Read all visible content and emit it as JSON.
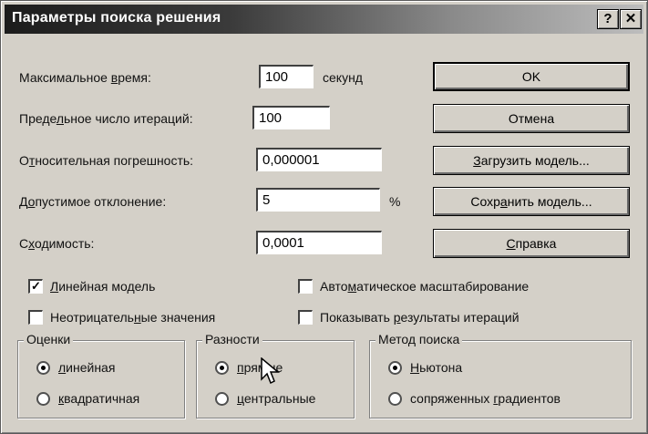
{
  "window": {
    "title": "Параметры поиска решения",
    "help_btn": "?",
    "close_btn": "✕"
  },
  "params": {
    "max_time_label_pre": "Максимальное ",
    "max_time_label_ul": "в",
    "max_time_label_post": "ремя:",
    "max_time_value": "100",
    "max_time_unit": "секунд",
    "iterations_label_pre": "Преде",
    "iterations_label_ul": "л",
    "iterations_label_post": "ьное число итераций:",
    "iterations_value": "100",
    "precision_label_pre": "О",
    "precision_label_ul": "т",
    "precision_label_post": "носительная погрешность:",
    "precision_value": "0,000001",
    "tolerance_label_pre": "Д",
    "tolerance_label_ul": "о",
    "tolerance_label_post": "пустимое отклонение:",
    "tolerance_value": "5",
    "tolerance_unit": "%",
    "convergence_label_pre": "С",
    "convergence_label_ul": "х",
    "convergence_label_post": "одимость:",
    "convergence_value": "0,0001"
  },
  "buttons": {
    "ok": "OK",
    "cancel": "Отмена",
    "load_pre": "",
    "load_ul": "З",
    "load_post": "агрузить модель...",
    "save_pre": "Сохр",
    "save_ul": "а",
    "save_post": "нить модель...",
    "help_pre": "",
    "help_ul": "С",
    "help_post": "правка"
  },
  "options": {
    "linear_model": {
      "pre": "",
      "ul": "Л",
      "post": "инейная модель",
      "checked": true
    },
    "nonnegative": {
      "pre": "Неотрицатель",
      "ul": "н",
      "post": "ые значения",
      "checked": false
    },
    "auto_scale": {
      "pre": "Авто",
      "ul": "м",
      "post": "атическое масштабирование",
      "checked": false
    },
    "show_iterations": {
      "pre": "Показывать ",
      "ul": "р",
      "post": "езультаты итераций",
      "checked": false
    },
    "check_mark": "✓"
  },
  "groups": {
    "estimates": {
      "legend": "Оценки",
      "opt1_pre": "",
      "opt1_ul": "л",
      "opt1_post": "инейная",
      "opt2_pre": "",
      "opt2_ul": "к",
      "opt2_post": "вадратичная"
    },
    "differences": {
      "legend": "Разности",
      "opt1_pre": "",
      "opt1_ul": "п",
      "opt1_post": "рямые",
      "opt2_pre": "",
      "opt2_ul": "ц",
      "opt2_post": "ентральные"
    },
    "search": {
      "legend": "Метод поиска",
      "opt1_pre": "",
      "opt1_ul": "Н",
      "opt1_post": "ьютона",
      "opt2_pre": "сопряженных ",
      "opt2_ul": "г",
      "opt2_post": "радиентов"
    }
  }
}
